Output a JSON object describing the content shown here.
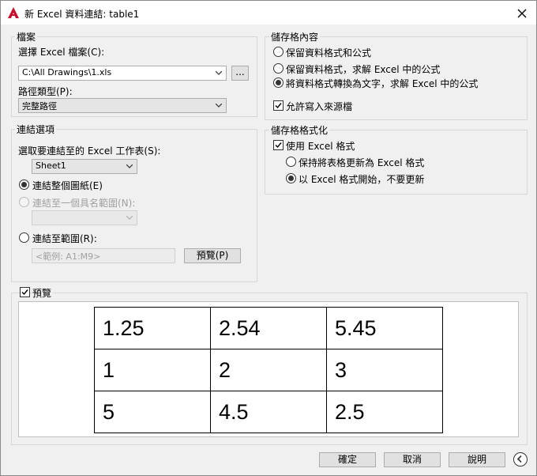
{
  "window": {
    "title": "新 Excel 資料連結: table1"
  },
  "file_group": {
    "title": "檔案",
    "choose_label": "選擇 Excel 檔案(C):",
    "file_value": "C:\\All Drawings\\1.xls",
    "browse_label": "...",
    "path_type_label": "路徑類型(P):",
    "path_type_value": "完整路徑"
  },
  "link_group": {
    "title": "連結選項",
    "sheet_label": "選取要連結至的 Excel 工作表(S):",
    "sheet_value": "Sheet1",
    "opt_entire_sheet": "連結整個圖紙(E)",
    "opt_named_range": "連結至一個具名範圍(N):",
    "opt_range": "連結至範圍(R):",
    "range_placeholder": "<範例: A1:M9>",
    "preview_button": "預覽(P)"
  },
  "cell_content_group": {
    "title": "儲存格內容",
    "opt_keep_formats_formulas": "保留資料格式和公式",
    "opt_keep_formats_solve": "保留資料格式，求解 Excel 中的公式",
    "opt_convert_text": "將資料格式轉換為文字，求解 Excel 中的公式",
    "allow_writes": "允許寫入來源檔"
  },
  "cell_format_group": {
    "title": "儲存格格式化",
    "use_excel_format": "使用 Excel 格式",
    "opt_keep_updated": "保持將表格更新為 Excel 格式",
    "opt_start_no_update": "以 Excel 格式開始，不要更新"
  },
  "preview": {
    "label": "預覽",
    "rows": [
      [
        "1.25",
        "2.54",
        "5.45"
      ],
      [
        "1",
        "2",
        "3"
      ],
      [
        "5",
        "4.5",
        "2.5"
      ]
    ]
  },
  "footer": {
    "ok": "確定",
    "cancel": "取消",
    "help": "說明"
  },
  "colors": {
    "app_icon": "#c8102e",
    "background": "#f0f0f0"
  }
}
